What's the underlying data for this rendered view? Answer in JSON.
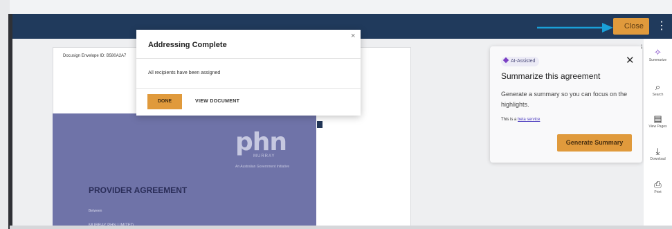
{
  "topbar": {
    "close_label": "Close",
    "more_icon": "more-vertical-icon",
    "colors": {
      "bar": "#203a5c",
      "accent": "#e09a3c",
      "arrow": "#1aa0d8"
    }
  },
  "document": {
    "envelope_id": "Docusign Envelope ID: B580A2A7",
    "logo_text": "phn",
    "logo_sub": "MURRAY",
    "logo_tagline": "An Australian Government Initiative",
    "agreement_title": "PROVIDER AGREEMENT",
    "between_label": "Between",
    "company": "MURRAY PHN LIMITED"
  },
  "modal": {
    "title": "Addressing Complete",
    "message": "All recipients have been assigned",
    "done_label": "DONE",
    "view_label": "VIEW DOCUMENT",
    "close_glyph": "×"
  },
  "ai_panel": {
    "badge": "AI-Assisted",
    "heading": "Summarize this agreement",
    "body": "Generate a summary so you can focus on the highlights.",
    "beta_prefix": "This is a",
    "beta_link": "beta service",
    "button": "Generate Summary",
    "close_glyph": "✕"
  },
  "rail": {
    "items": [
      {
        "icon": "sparkle-icon",
        "glyph": "✧",
        "label": "Summarize"
      },
      {
        "icon": "search-icon",
        "glyph": "⌕",
        "label": "Search"
      },
      {
        "icon": "document-icon",
        "glyph": "▤",
        "label": "View Pages"
      },
      {
        "icon": "download-icon",
        "glyph": "⤓",
        "label": "Download"
      },
      {
        "icon": "print-icon",
        "glyph": "⎙",
        "label": "Print"
      }
    ]
  }
}
